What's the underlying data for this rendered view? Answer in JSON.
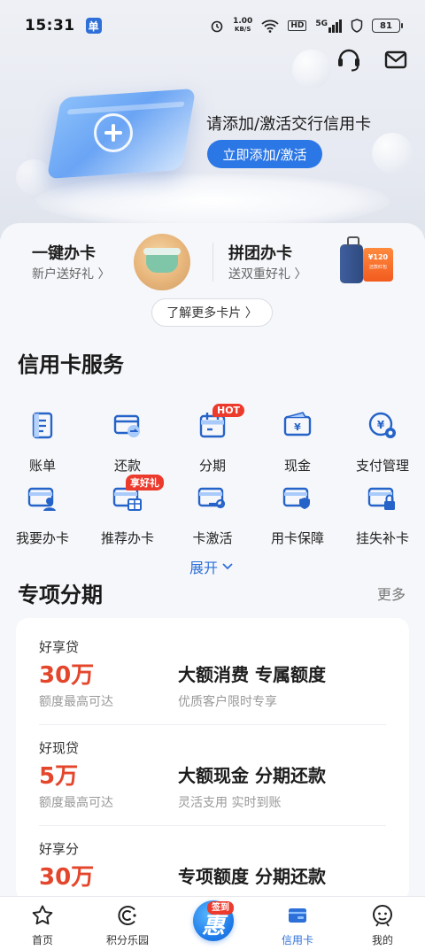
{
  "status_bar": {
    "time": "15:31",
    "app_badge": "单",
    "net_speed_value": "1.00",
    "net_speed_unit": "KB/S",
    "hd": "HD",
    "signal": "5G",
    "battery": "81"
  },
  "header": {
    "support_icon": "headset-icon",
    "message_icon": "mail-icon"
  },
  "hero": {
    "title": "请添加/激活交行信用卡",
    "button_label": "立即添加/激活"
  },
  "promos": [
    {
      "title": "一键办卡",
      "subtitle": "新户送好礼 〉"
    },
    {
      "title": "拼团办卡",
      "subtitle": "送双重好礼 〉"
    }
  ],
  "promo_coupon": {
    "value": "¥120",
    "caption": "还款红包"
  },
  "more_cards_label": "了解更多卡片 〉",
  "services": {
    "title": "信用卡服务",
    "items": [
      {
        "label": "账单",
        "icon": "bill-icon"
      },
      {
        "label": "还款",
        "icon": "repay-icon"
      },
      {
        "label": "分期",
        "icon": "installment-icon",
        "badge": "HOT"
      },
      {
        "label": "现金",
        "icon": "cash-icon"
      },
      {
        "label": "支付管理",
        "icon": "payment-settings-icon"
      },
      {
        "label": "我要办卡",
        "icon": "apply-card-icon"
      },
      {
        "label": "推荐办卡",
        "icon": "recommend-card-icon",
        "badge": "享好礼"
      },
      {
        "label": "卡激活",
        "icon": "card-activate-icon"
      },
      {
        "label": "用卡保障",
        "icon": "card-protect-icon"
      },
      {
        "label": "挂失补卡",
        "icon": "lost-card-icon"
      }
    ],
    "expand_label": "展开"
  },
  "installments": {
    "title": "专项分期",
    "more_label": "更多",
    "items": [
      {
        "name": "好享贷",
        "amount": "30万",
        "note": "额度最高可达",
        "feature": "大额消费 专属额度",
        "desc": "优质客户限时专享"
      },
      {
        "name": "好现贷",
        "amount": "5万",
        "note": "额度最高可达",
        "feature": "大额现金 分期还款",
        "desc": "灵活支用 实时到账"
      },
      {
        "name": "好享分",
        "amount": "30万",
        "note": "",
        "feature": "专项额度 分期还款",
        "desc": ""
      }
    ]
  },
  "tabbar": {
    "tabs": [
      {
        "label": "首页",
        "icon": "star-icon"
      },
      {
        "label": "积分乐园",
        "icon": "points-icon"
      },
      {
        "label": "",
        "icon": "checkin-icon"
      },
      {
        "label": "信用卡",
        "icon": "credit-card-icon",
        "active": true
      },
      {
        "label": "我的",
        "icon": "profile-icon"
      }
    ],
    "checkin_badge": "签到",
    "checkin_glyph": "惠"
  },
  "colors": {
    "brand_blue": "#2c77e6",
    "accent_red": "#e4462c",
    "badge_red": "#ec3a2c"
  }
}
